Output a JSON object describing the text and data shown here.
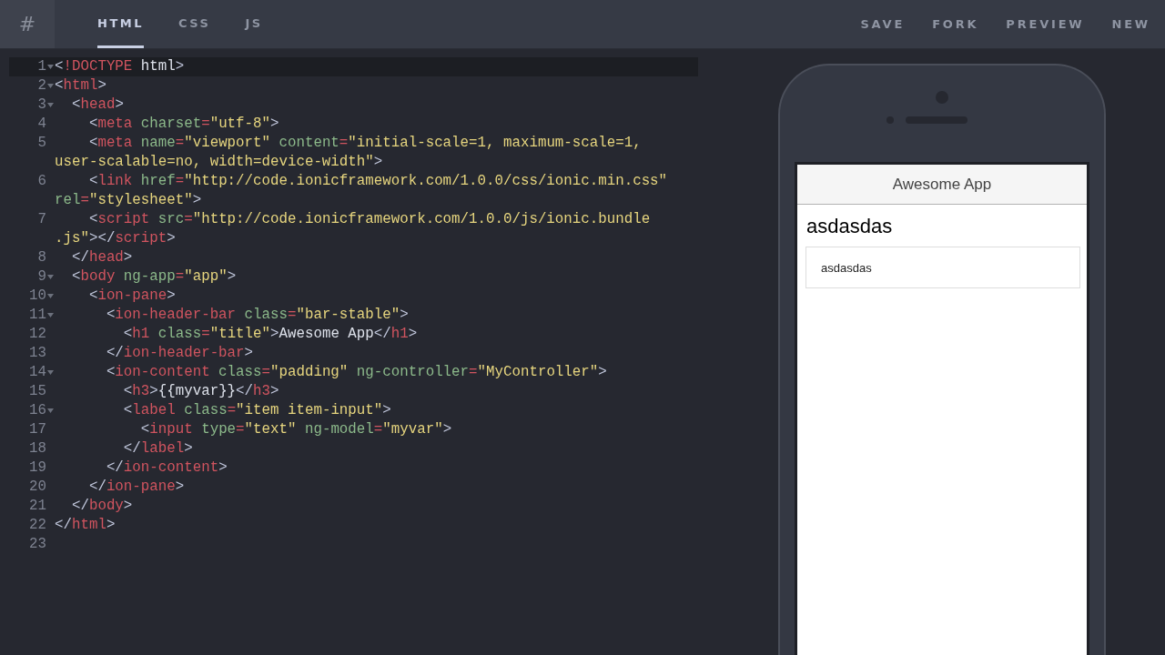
{
  "logo": {
    "glyph": "#"
  },
  "tabs": [
    {
      "label": "HTML",
      "selected": true
    },
    {
      "label": "CSS",
      "selected": false
    },
    {
      "label": "JS",
      "selected": false
    }
  ],
  "actions": [
    "SAVE",
    "FORK",
    "PREVIEW",
    "NEW"
  ],
  "editor": {
    "lines": [
      {
        "number": "1",
        "foldable": true,
        "active": true,
        "rows": [
          {
            "tokens": [
              {
                "kind": "punct",
                "text": "<"
              },
              {
                "kind": "tag",
                "text": "!DOCTYPE"
              },
              {
                "kind": "text",
                "text": " html"
              },
              {
                "kind": "punct",
                "text": ">"
              }
            ]
          }
        ]
      },
      {
        "number": "2",
        "foldable": true,
        "active": false,
        "rows": [
          {
            "tokens": [
              {
                "kind": "punct",
                "text": "<"
              },
              {
                "kind": "tag",
                "text": "html"
              },
              {
                "kind": "punct",
                "text": ">"
              }
            ]
          }
        ]
      },
      {
        "number": "3",
        "foldable": true,
        "active": false,
        "rows": [
          {
            "tokens": [
              {
                "kind": "punct",
                "text": "  <"
              },
              {
                "kind": "tag",
                "text": "head"
              },
              {
                "kind": "punct",
                "text": ">"
              }
            ]
          }
        ]
      },
      {
        "number": "4",
        "foldable": false,
        "active": false,
        "rows": [
          {
            "tokens": [
              {
                "kind": "punct",
                "text": "    <"
              },
              {
                "kind": "tag",
                "text": "meta"
              },
              {
                "kind": "attr",
                "text": " charset"
              },
              {
                "kind": "tag",
                "text": "="
              },
              {
                "kind": "string",
                "text": "\"utf-8\""
              },
              {
                "kind": "punct",
                "text": ">"
              }
            ]
          }
        ]
      },
      {
        "number": "5",
        "foldable": false,
        "active": false,
        "rows": [
          {
            "tokens": [
              {
                "kind": "punct",
                "text": "    <"
              },
              {
                "kind": "tag",
                "text": "meta"
              },
              {
                "kind": "attr",
                "text": " name"
              },
              {
                "kind": "tag",
                "text": "="
              },
              {
                "kind": "string",
                "text": "\"viewport\""
              },
              {
                "kind": "attr",
                "text": " content"
              },
              {
                "kind": "tag",
                "text": "="
              },
              {
                "kind": "string",
                "text": "\"initial-scale=1, maximum-scale=1,"
              }
            ]
          },
          {
            "tokens": [
              {
                "kind": "string",
                "text": "user-scalable=no, width=device-width\""
              },
              {
                "kind": "punct",
                "text": ">"
              }
            ]
          }
        ]
      },
      {
        "number": "6",
        "foldable": false,
        "active": false,
        "rows": [
          {
            "tokens": [
              {
                "kind": "punct",
                "text": "    <"
              },
              {
                "kind": "tag",
                "text": "link"
              },
              {
                "kind": "attr",
                "text": " href"
              },
              {
                "kind": "tag",
                "text": "="
              },
              {
                "kind": "string",
                "text": "\"http://code.ionicframework.com/1.0.0/css/ionic.min.css\""
              }
            ]
          },
          {
            "tokens": [
              {
                "kind": "attr",
                "text": "rel"
              },
              {
                "kind": "tag",
                "text": "="
              },
              {
                "kind": "string",
                "text": "\"stylesheet\""
              },
              {
                "kind": "punct",
                "text": ">"
              }
            ]
          }
        ]
      },
      {
        "number": "7",
        "foldable": false,
        "active": false,
        "rows": [
          {
            "tokens": [
              {
                "kind": "punct",
                "text": "    <"
              },
              {
                "kind": "tag",
                "text": "script"
              },
              {
                "kind": "attr",
                "text": " src"
              },
              {
                "kind": "tag",
                "text": "="
              },
              {
                "kind": "string",
                "text": "\"http://code.ionicframework.com/1.0.0/js/ionic.bundle"
              }
            ]
          },
          {
            "tokens": [
              {
                "kind": "string",
                "text": ".js\""
              },
              {
                "kind": "punct",
                "text": "></"
              },
              {
                "kind": "tag",
                "text": "script"
              },
              {
                "kind": "punct",
                "text": ">"
              }
            ]
          }
        ]
      },
      {
        "number": "8",
        "foldable": false,
        "active": false,
        "rows": [
          {
            "tokens": [
              {
                "kind": "punct",
                "text": "  </"
              },
              {
                "kind": "tag",
                "text": "head"
              },
              {
                "kind": "punct",
                "text": ">"
              }
            ]
          }
        ]
      },
      {
        "number": "9",
        "foldable": true,
        "active": false,
        "rows": [
          {
            "tokens": [
              {
                "kind": "punct",
                "text": "  <"
              },
              {
                "kind": "tag",
                "text": "body"
              },
              {
                "kind": "attr",
                "text": " ng-app"
              },
              {
                "kind": "tag",
                "text": "="
              },
              {
                "kind": "string",
                "text": "\"app\""
              },
              {
                "kind": "punct",
                "text": ">"
              }
            ]
          }
        ]
      },
      {
        "number": "10",
        "foldable": true,
        "active": false,
        "rows": [
          {
            "tokens": [
              {
                "kind": "punct",
                "text": "    <"
              },
              {
                "kind": "tag",
                "text": "ion-pane"
              },
              {
                "kind": "punct",
                "text": ">"
              }
            ]
          }
        ]
      },
      {
        "number": "11",
        "foldable": true,
        "active": false,
        "rows": [
          {
            "tokens": [
              {
                "kind": "punct",
                "text": "      <"
              },
              {
                "kind": "tag",
                "text": "ion-header-bar"
              },
              {
                "kind": "attr",
                "text": " class"
              },
              {
                "kind": "tag",
                "text": "="
              },
              {
                "kind": "string",
                "text": "\"bar-stable\""
              },
              {
                "kind": "punct",
                "text": ">"
              }
            ]
          }
        ]
      },
      {
        "number": "12",
        "foldable": false,
        "active": false,
        "rows": [
          {
            "tokens": [
              {
                "kind": "punct",
                "text": "        <"
              },
              {
                "kind": "tag",
                "text": "h1"
              },
              {
                "kind": "attr",
                "text": " class"
              },
              {
                "kind": "tag",
                "text": "="
              },
              {
                "kind": "string",
                "text": "\"title\""
              },
              {
                "kind": "punct",
                "text": ">"
              },
              {
                "kind": "text",
                "text": "Awesome App"
              },
              {
                "kind": "punct",
                "text": "</"
              },
              {
                "kind": "tag",
                "text": "h1"
              },
              {
                "kind": "punct",
                "text": ">"
              }
            ]
          }
        ]
      },
      {
        "number": "13",
        "foldable": false,
        "active": false,
        "rows": [
          {
            "tokens": [
              {
                "kind": "punct",
                "text": "      </"
              },
              {
                "kind": "tag",
                "text": "ion-header-bar"
              },
              {
                "kind": "punct",
                "text": ">"
              }
            ]
          }
        ]
      },
      {
        "number": "14",
        "foldable": true,
        "active": false,
        "rows": [
          {
            "tokens": [
              {
                "kind": "punct",
                "text": "      <"
              },
              {
                "kind": "tag",
                "text": "ion-content"
              },
              {
                "kind": "attr",
                "text": " class"
              },
              {
                "kind": "tag",
                "text": "="
              },
              {
                "kind": "string",
                "text": "\"padding\""
              },
              {
                "kind": "attr",
                "text": " ng-controller"
              },
              {
                "kind": "tag",
                "text": "="
              },
              {
                "kind": "string",
                "text": "\"MyController\""
              },
              {
                "kind": "punct",
                "text": ">"
              }
            ]
          }
        ]
      },
      {
        "number": "15",
        "foldable": false,
        "active": false,
        "rows": [
          {
            "tokens": [
              {
                "kind": "punct",
                "text": "        <"
              },
              {
                "kind": "tag",
                "text": "h3"
              },
              {
                "kind": "punct",
                "text": ">"
              },
              {
                "kind": "text",
                "text": "{{myvar}}"
              },
              {
                "kind": "punct",
                "text": "</"
              },
              {
                "kind": "tag",
                "text": "h3"
              },
              {
                "kind": "punct",
                "text": ">"
              }
            ]
          }
        ]
      },
      {
        "number": "16",
        "foldable": true,
        "active": false,
        "rows": [
          {
            "tokens": [
              {
                "kind": "punct",
                "text": "        <"
              },
              {
                "kind": "tag",
                "text": "label"
              },
              {
                "kind": "attr",
                "text": " class"
              },
              {
                "kind": "tag",
                "text": "="
              },
              {
                "kind": "string",
                "text": "\"item item-input\""
              },
              {
                "kind": "punct",
                "text": ">"
              }
            ]
          }
        ]
      },
      {
        "number": "17",
        "foldable": false,
        "active": false,
        "rows": [
          {
            "tokens": [
              {
                "kind": "punct",
                "text": "          <"
              },
              {
                "kind": "tag",
                "text": "input"
              },
              {
                "kind": "attr",
                "text": " type"
              },
              {
                "kind": "tag",
                "text": "="
              },
              {
                "kind": "string",
                "text": "\"text\""
              },
              {
                "kind": "attr",
                "text": " ng-model"
              },
              {
                "kind": "tag",
                "text": "="
              },
              {
                "kind": "string",
                "text": "\"myvar\""
              },
              {
                "kind": "punct",
                "text": ">"
              }
            ]
          }
        ]
      },
      {
        "number": "18",
        "foldable": false,
        "active": false,
        "rows": [
          {
            "tokens": [
              {
                "kind": "punct",
                "text": "        </"
              },
              {
                "kind": "tag",
                "text": "label"
              },
              {
                "kind": "punct",
                "text": ">"
              }
            ]
          }
        ]
      },
      {
        "number": "19",
        "foldable": false,
        "active": false,
        "rows": [
          {
            "tokens": [
              {
                "kind": "punct",
                "text": "      </"
              },
              {
                "kind": "tag",
                "text": "ion-content"
              },
              {
                "kind": "punct",
                "text": ">"
              }
            ]
          }
        ]
      },
      {
        "number": "20",
        "foldable": false,
        "active": false,
        "rows": [
          {
            "tokens": [
              {
                "kind": "punct",
                "text": "    </"
              },
              {
                "kind": "tag",
                "text": "ion-pane"
              },
              {
                "kind": "punct",
                "text": ">"
              }
            ]
          }
        ]
      },
      {
        "number": "21",
        "foldable": false,
        "active": false,
        "rows": [
          {
            "tokens": [
              {
                "kind": "punct",
                "text": "  </"
              },
              {
                "kind": "tag",
                "text": "body"
              },
              {
                "kind": "punct",
                "text": ">"
              }
            ]
          }
        ]
      },
      {
        "number": "22",
        "foldable": false,
        "active": false,
        "rows": [
          {
            "tokens": [
              {
                "kind": "punct",
                "text": "</"
              },
              {
                "kind": "tag",
                "text": "html"
              },
              {
                "kind": "punct",
                "text": ">"
              }
            ]
          }
        ]
      },
      {
        "number": "23",
        "foldable": false,
        "active": false
      }
    ]
  },
  "preview": {
    "header_title": "Awesome App",
    "heading": "asdasdas",
    "input_value": "asdasdas"
  }
}
